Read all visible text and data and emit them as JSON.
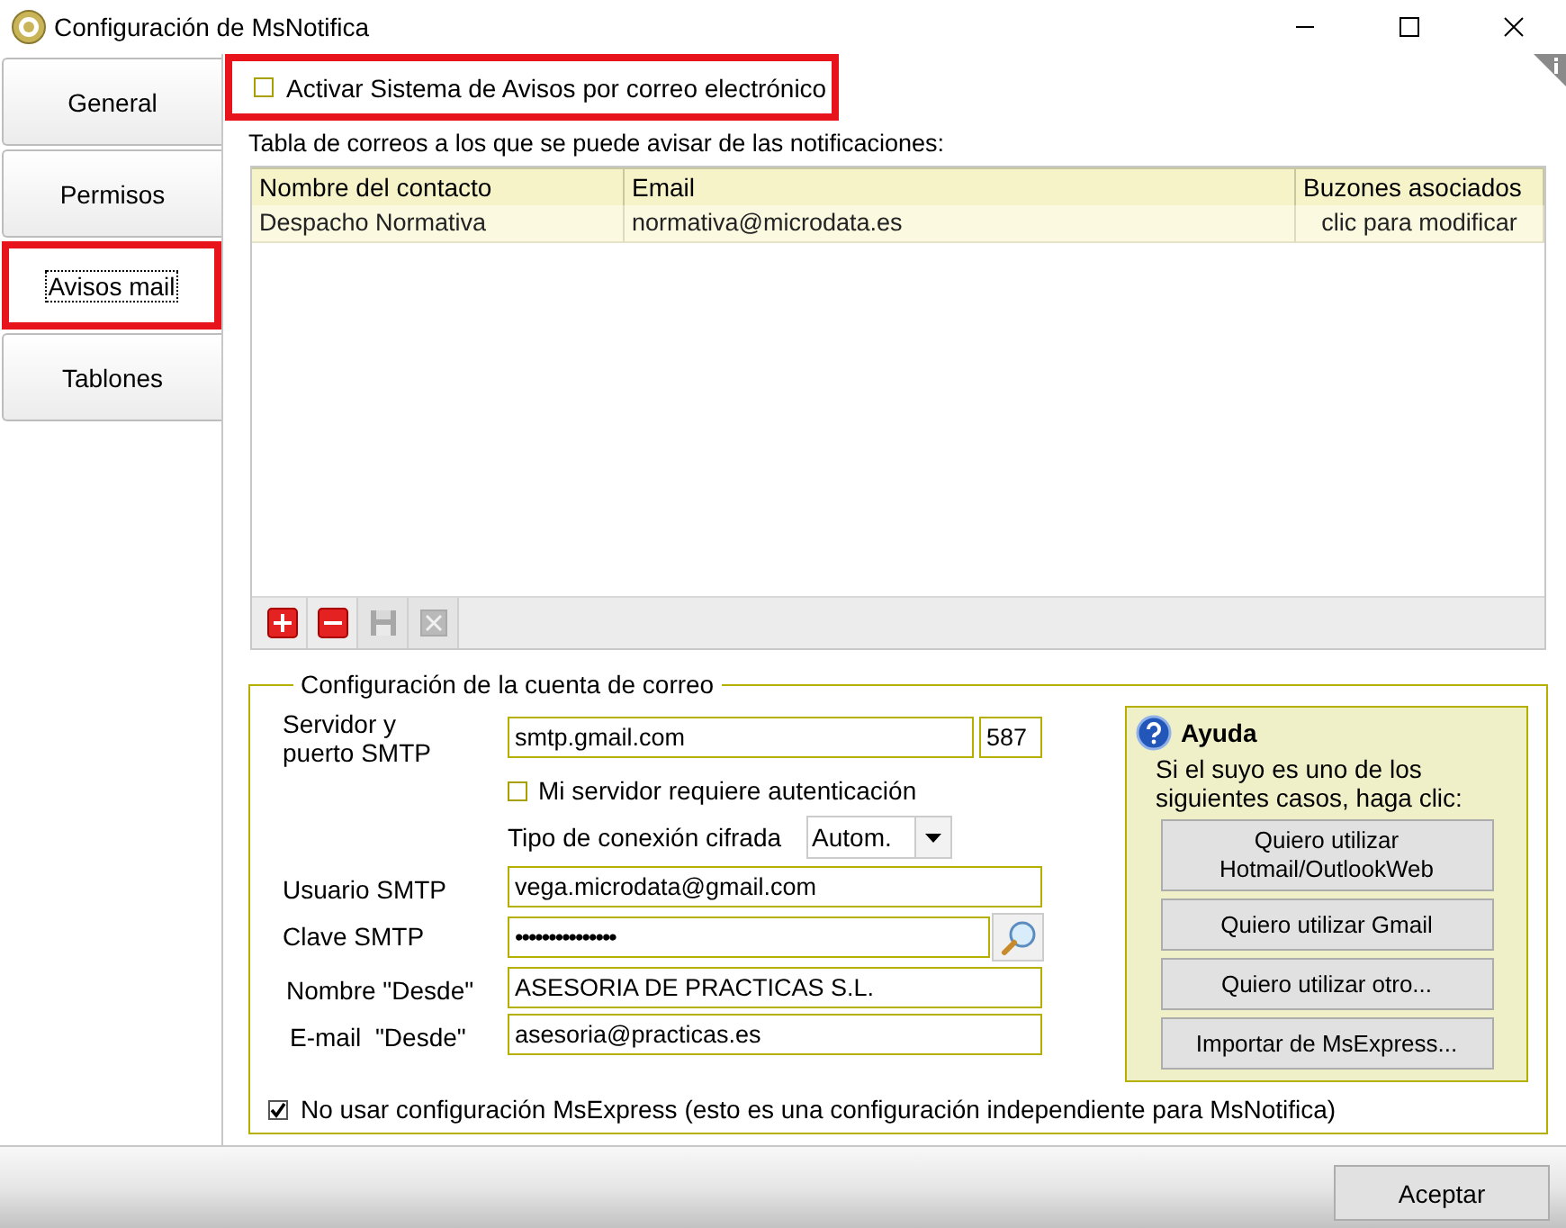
{
  "window": {
    "title": "Configuración de MsNotifica"
  },
  "tabs": [
    {
      "label": "General",
      "selected": false,
      "highlighted": false
    },
    {
      "label": "Permisos",
      "selected": false,
      "highlighted": false
    },
    {
      "label": "Avisos mail",
      "selected": true,
      "highlighted": true
    },
    {
      "label": "Tablones",
      "selected": false,
      "highlighted": false
    }
  ],
  "activate": {
    "label": "Activar Sistema de Avisos por correo electrónico",
    "checked": false,
    "highlighted": true
  },
  "table": {
    "caption": "Tabla de correos a los que se puede avisar de las notificaciones:",
    "columns": [
      "Nombre del contacto",
      "Email",
      "Buzones asociados"
    ],
    "rows": [
      [
        "Despacho Normativa",
        "normativa@microdata.es",
        "clic para modificar"
      ]
    ],
    "tools": [
      {
        "kind": "add",
        "disabled": false
      },
      {
        "kind": "remove",
        "disabled": false
      },
      {
        "kind": "save",
        "disabled": true
      },
      {
        "kind": "cancel",
        "disabled": true
      }
    ]
  },
  "account": {
    "title": "Configuración de la cuenta de correo",
    "server": {
      "label": "Servidor y puerto SMTP",
      "value": "smtp.gmail.com",
      "port": "587"
    },
    "auth": {
      "label": "Mi servidor requiere autenticación",
      "checked": false
    },
    "encryption": {
      "label": "Tipo de conexión cifrada",
      "value": "Autom."
    },
    "user": {
      "label": "Usuario SMTP",
      "value": "vega.microdata@gmail.com"
    },
    "password": {
      "label": "Clave SMTP",
      "value": "•••••••••••••••"
    },
    "from_name": {
      "label": "Nombre \"Desde\"",
      "value": "ASESORIA DE PRACTICAS S.L."
    },
    "from_email": {
      "label": "E-mail  \"Desde\"",
      "value": "asesoria@practicas.es"
    },
    "independent": {
      "label": "No usar configuración MsExpress (esto es una configuración independiente para MsNotifica)",
      "checked": true
    },
    "help": {
      "title": "Ayuda",
      "text": "Si el suyo es uno de los siguientes casos, haga clic:",
      "buttons": [
        "Quiero utilizar Hotmail/OutlookWeb",
        "Quiero utilizar Gmail",
        "Quiero utilizar otro...",
        "Importar de MsExpress..."
      ]
    }
  },
  "buttons": [
    "Aceptar"
  ]
}
